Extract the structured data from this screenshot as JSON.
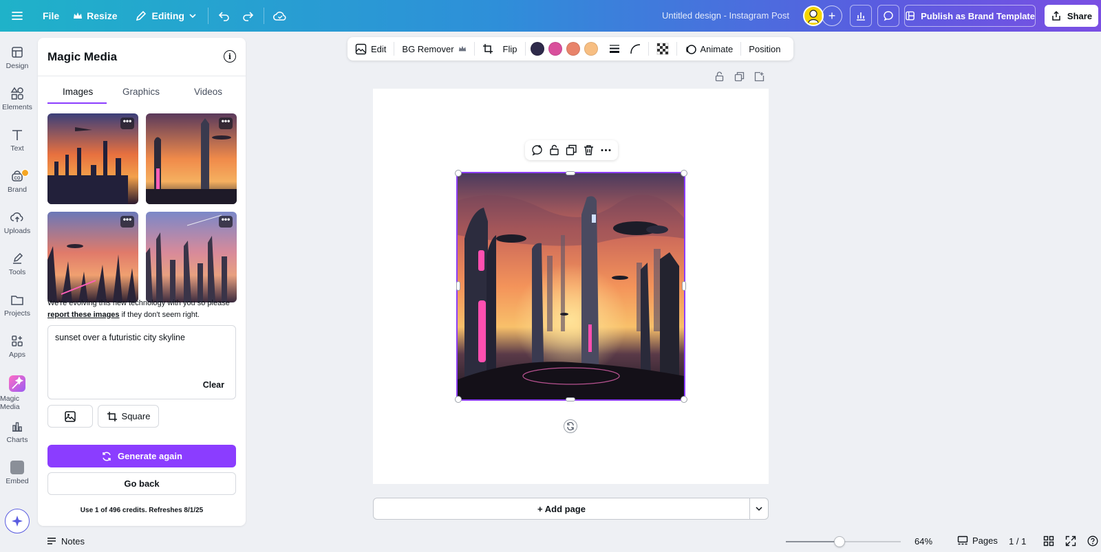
{
  "topbar": {
    "file": "File",
    "resize": "Resize",
    "mode": "Editing",
    "doc_title": "Untitled design - Instagram Post",
    "publish": "Publish as Brand Template",
    "share": "Share"
  },
  "rail": {
    "items": [
      "Design",
      "Elements",
      "Text",
      "Brand",
      "Uploads",
      "Tools",
      "Projects",
      "Apps",
      "Magic Media",
      "Charts",
      "Embed"
    ]
  },
  "panel": {
    "title": "Magic Media",
    "tabs": [
      "Images",
      "Graphics",
      "Videos"
    ],
    "active_tab": "Images",
    "disclaimer_prefix": "We're evolving this new technology with you so please",
    "disclaimer_link": "report these images",
    "disclaimer_suffix": "if they don't seem right.",
    "prompt": "sunset over a futuristic city skyline",
    "clear": "Clear",
    "aspect": "Square",
    "generate": "Generate again",
    "back": "Go back",
    "credits": "Use 1 of 496 credits. Refreshes 8/1/25",
    "more_glyph": "•••"
  },
  "context_toolbar": {
    "edit": "Edit",
    "bg_remover": "BG Remover",
    "flip": "Flip",
    "animate": "Animate",
    "position": "Position",
    "colors": [
      "#2e2a4a",
      "#d94f9c",
      "#e8836a",
      "#f7be82"
    ]
  },
  "canvas": {
    "add_page": "+ Add page"
  },
  "bottombar": {
    "notes": "Notes",
    "zoom": "64%",
    "zoom_fraction": 0.47,
    "pages": "Pages",
    "page_count": "1 / 1"
  }
}
